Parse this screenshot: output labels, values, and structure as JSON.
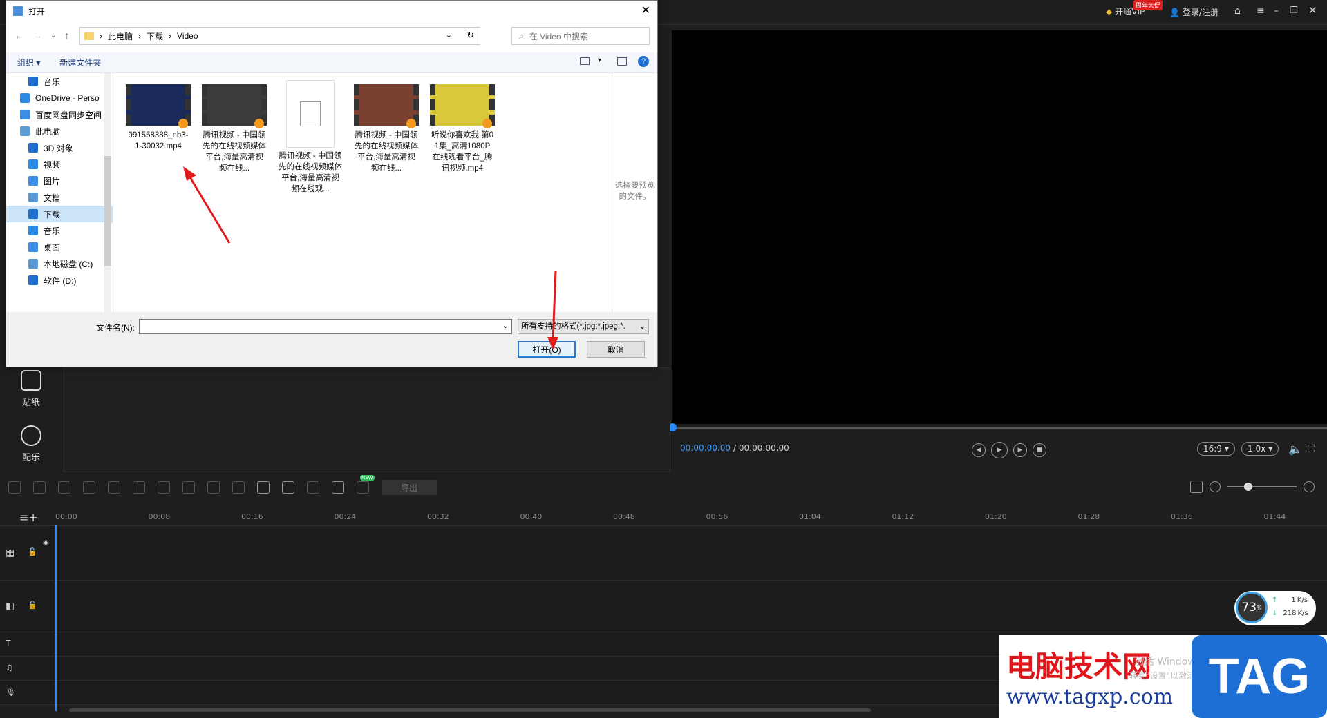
{
  "header": {
    "vip_label": "开通VIP",
    "promo_badge": "周年大促",
    "login_label": "登录/注册"
  },
  "player": {
    "time_current": "00:00:00.00",
    "time_total": "/ 00:00:00.00",
    "aspect": "16:9",
    "speed": "1.0x"
  },
  "sidebar": {
    "items": [
      {
        "label": "贴纸",
        "icon": "sticker-icon"
      },
      {
        "label": "配乐",
        "icon": "music-icon"
      }
    ]
  },
  "timeline": {
    "ticks": [
      "00:00",
      "00:08",
      "00:16",
      "00:24",
      "00:32",
      "00:40",
      "00:48",
      "00:56",
      "01:04",
      "01:12",
      "01:20",
      "01:28",
      "01:36",
      "01:44"
    ],
    "export_label": "导出",
    "new_badge": "NEW"
  },
  "net_monitor": {
    "percent": "73",
    "unit": "%",
    "up": "1",
    "up_unit": "K/s",
    "down": "218",
    "down_unit": "K/s"
  },
  "dialog": {
    "title": "打开",
    "breadcrumb": [
      "此电脑",
      "下载",
      "Video"
    ],
    "search_placeholder": "在 Video 中搜索",
    "organize": "组织 ▾",
    "new_folder": "新建文件夹",
    "nav": [
      {
        "label": "音乐",
        "indent": 1
      },
      {
        "label": "OneDrive - Perso",
        "indent": 0
      },
      {
        "label": "百度网盘同步空间",
        "indent": 0
      },
      {
        "label": "此电脑",
        "indent": 0
      },
      {
        "label": "3D 对象",
        "indent": 1
      },
      {
        "label": "视频",
        "indent": 1
      },
      {
        "label": "图片",
        "indent": 1
      },
      {
        "label": "文档",
        "indent": 1
      },
      {
        "label": "下载",
        "indent": 1,
        "selected": true
      },
      {
        "label": "音乐",
        "indent": 1
      },
      {
        "label": "桌面",
        "indent": 1
      },
      {
        "label": "本地磁盘 (C:)",
        "indent": 1
      },
      {
        "label": "软件 (D:)",
        "indent": 1
      }
    ],
    "files": [
      {
        "name": "991558388_nb3-1-30032.mp4",
        "type": "video"
      },
      {
        "name": "腾讯视频 - 中国领先的在线视频媒体平台,海量高清视频在线...",
        "type": "video"
      },
      {
        "name": "腾讯视频 - 中国领先的在线视频媒体平台,海量高清视频在线观...",
        "type": "doc"
      },
      {
        "name": "腾讯视频 - 中国领先的在线视频媒体平台,海量高清视频在线...",
        "type": "video"
      },
      {
        "name": "听说你喜欢我 第01集_高清1080P在线观看平台_腾讯视频.mp4",
        "type": "video"
      }
    ],
    "preview_hint": "选择要预览的文件。",
    "filename_label": "文件名(N):",
    "filename_value": "",
    "filetype": "所有支持的格式(*.jpg;*.jpeg;*.",
    "open_button": "打开(O)",
    "cancel_button": "取消"
  },
  "watermark": {
    "site_name": "电脑技术网",
    "url": "www.tagxp.com",
    "logo": "TAG",
    "activate_line1": "激活 Windows",
    "activate_line2": "转到\"设置\"以激活 Windows。"
  }
}
